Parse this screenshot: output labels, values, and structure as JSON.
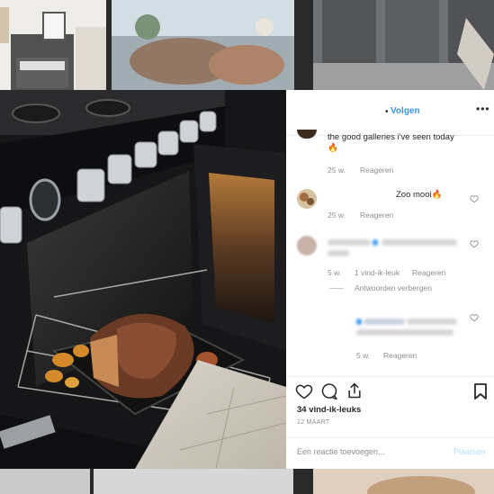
{
  "header": {
    "follow_label": "Volgen",
    "more_label": "•••"
  },
  "comments": [
    {
      "text": "the good galleries i've seen today",
      "emoji": "🔥",
      "age": "25 w.",
      "reply_label": "Reageren"
    },
    {
      "text": "Zoo mooi",
      "emoji": "🔥",
      "age": "25 w.",
      "reply_label": "Reageren"
    },
    {
      "age": "5 w.",
      "likes_label": "1 vind-ik-leuk",
      "reply_label": "Reageren",
      "hide_replies_label": "Antwoorden verbergen"
    },
    {
      "age": "5 w.",
      "reply_label": "Reageren"
    }
  ],
  "post": {
    "likes": "34 vind-ik-leuks",
    "date": "12 MAART"
  },
  "composer": {
    "placeholder": "Een reactie toevoegen...",
    "submit_label": "Plaatsen"
  },
  "colors": {
    "accent": "#3897f0",
    "muted": "#8e8e8e",
    "text": "#262626"
  }
}
